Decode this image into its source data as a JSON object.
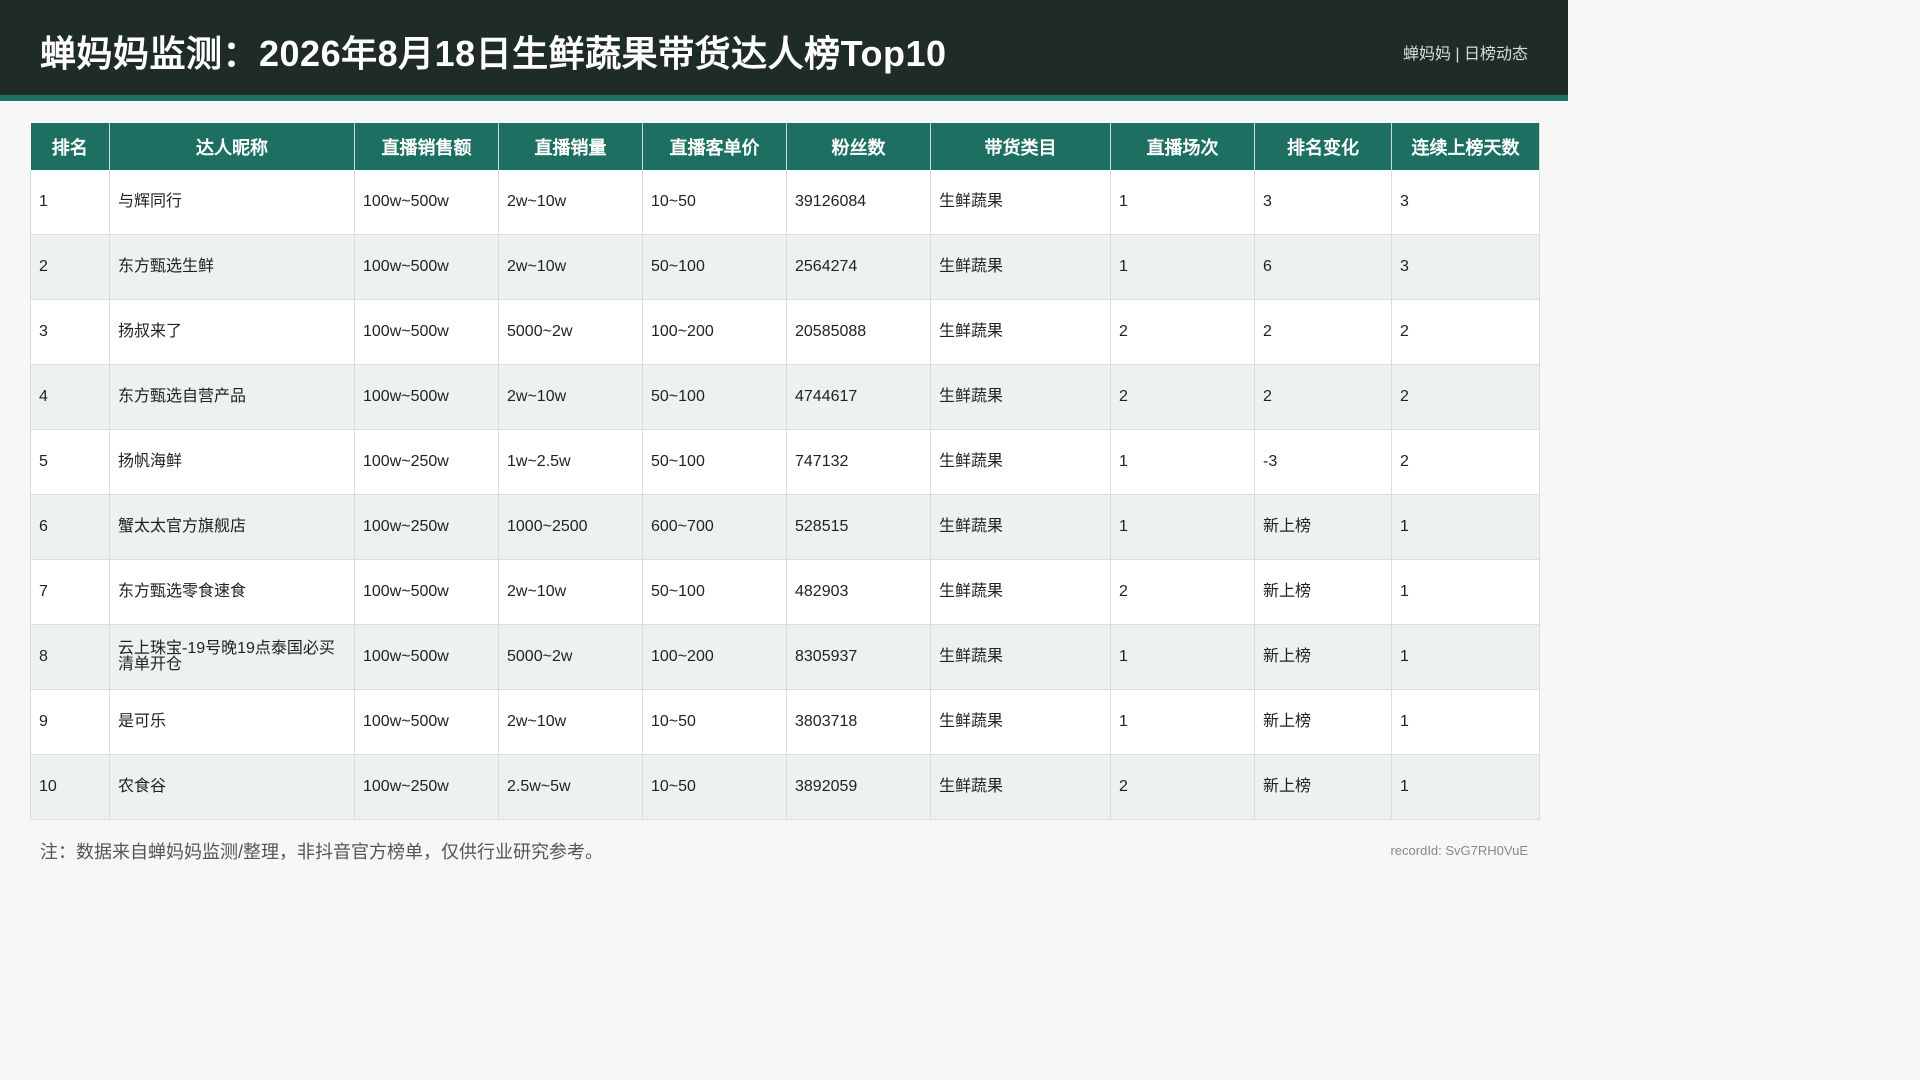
{
  "header": {
    "title": "蝉妈妈监测：2026年8月18日生鲜蔬果带货达人榜Top10",
    "brand": "蝉妈妈 | 日榜动态"
  },
  "table": {
    "columns": [
      "排名",
      "达人昵称",
      "直播销售额",
      "直播销量",
      "直播客单价",
      "粉丝数",
      "带货类目",
      "直播场次",
      "排名变化",
      "连续上榜天数"
    ],
    "rows": [
      [
        "1",
        "与辉同行",
        "100w~500w",
        "2w~10w",
        "10~50",
        "39126084",
        "生鲜蔬果",
        "1",
        "3",
        "3"
      ],
      [
        "2",
        "东方甄选生鲜",
        "100w~500w",
        "2w~10w",
        "50~100",
        "2564274",
        "生鲜蔬果",
        "1",
        "6",
        "3"
      ],
      [
        "3",
        "扬叔来了",
        "100w~500w",
        "5000~2w",
        "100~200",
        "20585088",
        "生鲜蔬果",
        "2",
        "2",
        "2"
      ],
      [
        "4",
        "东方甄选自营产品",
        "100w~500w",
        "2w~10w",
        "50~100",
        "4744617",
        "生鲜蔬果",
        "2",
        "2",
        "2"
      ],
      [
        "5",
        "扬帆海鲜",
        "100w~250w",
        "1w~2.5w",
        "50~100",
        "747132",
        "生鲜蔬果",
        "1",
        "-3",
        "2"
      ],
      [
        "6",
        "蟹太太官方旗舰店",
        "100w~250w",
        "1000~2500",
        "600~700",
        "528515",
        "生鲜蔬果",
        "1",
        "新上榜",
        "1"
      ],
      [
        "7",
        "东方甄选零食速食",
        "100w~500w",
        "2w~10w",
        "50~100",
        "482903",
        "生鲜蔬果",
        "2",
        "新上榜",
        "1"
      ],
      [
        "8",
        "云上珠宝-19号晚19点泰国必买清单开仓",
        "100w~500w",
        "5000~2w",
        "100~200",
        "8305937",
        "生鲜蔬果",
        "1",
        "新上榜",
        "1"
      ],
      [
        "9",
        "是可乐",
        "100w~500w",
        "2w~10w",
        "10~50",
        "3803718",
        "生鲜蔬果",
        "1",
        "新上榜",
        "1"
      ],
      [
        "10",
        "农食谷",
        "100w~250w",
        "2.5w~5w",
        "10~50",
        "3892059",
        "生鲜蔬果",
        "2",
        "新上榜",
        "1"
      ]
    ]
  },
  "footer": {
    "note": "注：数据来自蝉妈妈监测/整理，非抖音官方榜单，仅供行业研究参考。",
    "record": "recordId: SvG7RH0VuE"
  },
  "colors": {
    "header_bg": "#1f2b27",
    "accent": "#1d6f61",
    "row_alt": "#ecf2ef"
  }
}
